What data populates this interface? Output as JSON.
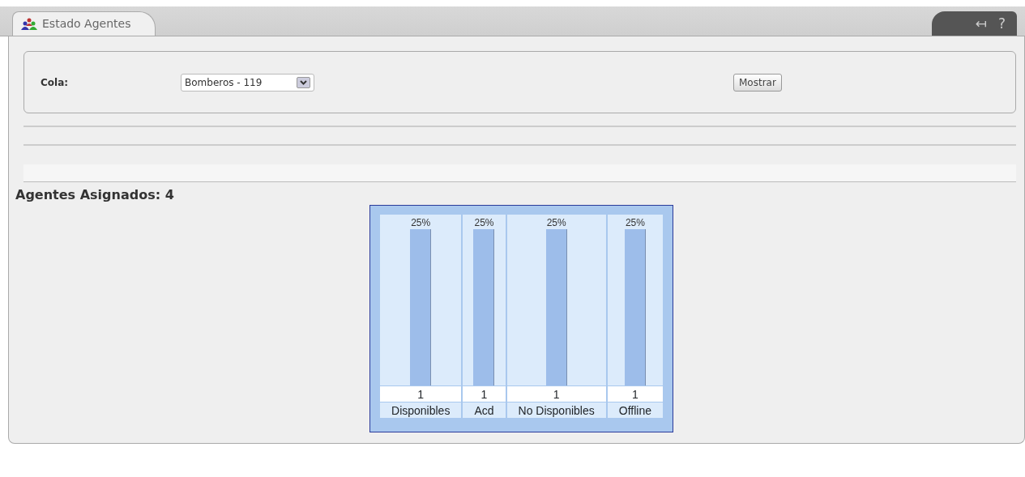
{
  "tab": {
    "label": "Estado Agentes",
    "selected": true
  },
  "corner_buttons": [
    "↤",
    "?"
  ],
  "filter": {
    "label": "Cola:",
    "value": "Bomberos - 119",
    "button": "Mostrar"
  },
  "heading": "Agentes Asignados: 4",
  "chart_columns": [
    {
      "percent": "25%",
      "level": 1,
      "count": "1",
      "label": "Disponibles"
    },
    {
      "percent": "25%",
      "level": 1,
      "count": "1",
      "label": "Acd"
    },
    {
      "percent": "25%",
      "level": 1,
      "count": "1",
      "label": "No Disponibles"
    },
    {
      "percent": "25%",
      "level": 1,
      "count": "1",
      "label": "Offline"
    }
  ]
}
